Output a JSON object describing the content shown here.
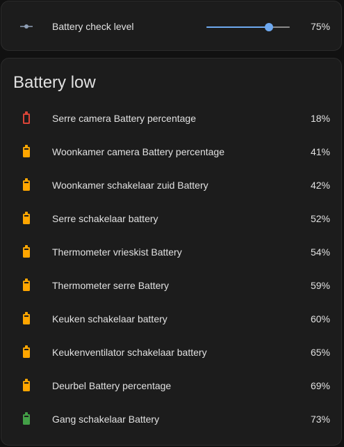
{
  "setting": {
    "label": "Battery check level",
    "value_text": "75%",
    "value": 0.75,
    "icon": "slider-icon",
    "accent": "#6ea9f0"
  },
  "battery_card": {
    "title": "Battery low",
    "items": [
      {
        "name": "Serre camera Battery percentage",
        "value": "18%",
        "level": 0.18,
        "color": "#db4437",
        "icon": "battery-outline-icon"
      },
      {
        "name": "Woonkamer camera Battery percentage",
        "value": "41%",
        "level": 0.41,
        "color": "#ffa600",
        "icon": "battery-icon"
      },
      {
        "name": "Woonkamer schakelaar zuid Battery",
        "value": "42%",
        "level": 0.42,
        "color": "#ffa600",
        "icon": "battery-icon"
      },
      {
        "name": "Serre schakelaar battery",
        "value": "52%",
        "level": 0.52,
        "color": "#ffa600",
        "icon": "battery-icon"
      },
      {
        "name": "Thermometer vrieskist Battery",
        "value": "54%",
        "level": 0.54,
        "color": "#ffa600",
        "icon": "battery-icon"
      },
      {
        "name": "Thermometer serre Battery",
        "value": "59%",
        "level": 0.59,
        "color": "#ffa600",
        "icon": "battery-icon"
      },
      {
        "name": "Keuken schakelaar battery",
        "value": "60%",
        "level": 0.6,
        "color": "#ffa600",
        "icon": "battery-icon"
      },
      {
        "name": "Keukenventilator schakelaar battery",
        "value": "65%",
        "level": 0.65,
        "color": "#ffa600",
        "icon": "battery-icon"
      },
      {
        "name": "Deurbel Battery percentage",
        "value": "69%",
        "level": 0.69,
        "color": "#ffa600",
        "icon": "battery-icon"
      },
      {
        "name": "Gang schakelaar Battery",
        "value": "73%",
        "level": 0.73,
        "color": "#43a047",
        "icon": "battery-icon"
      }
    ]
  }
}
